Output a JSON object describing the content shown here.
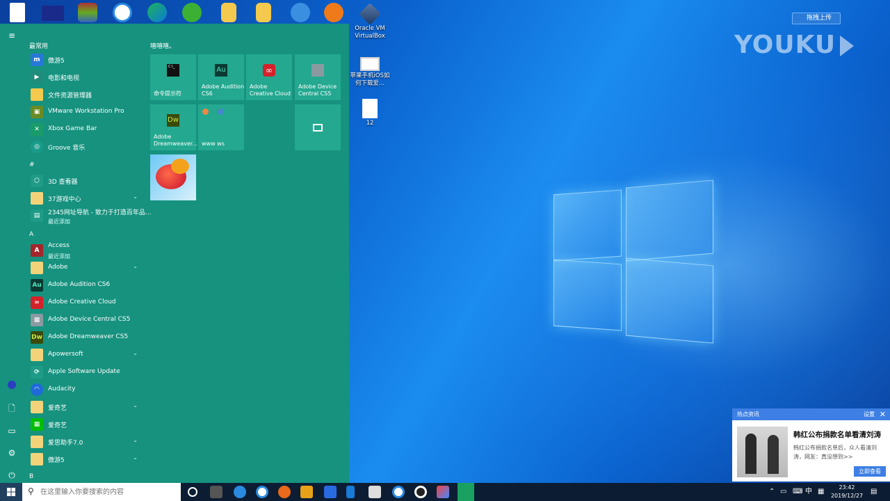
{
  "desktop": {
    "icons": [
      {
        "label": "Oracle VM VirtualBox"
      },
      {
        "label": "苹果手机iOS如何下载爱..."
      },
      {
        "label": "12"
      }
    ],
    "watermark": "YOUKU",
    "upload_button": "拖拽上传"
  },
  "start_menu": {
    "sections": {
      "frequent": "最常用",
      "hash": "#",
      "a": "A",
      "b": "B"
    },
    "apps": [
      {
        "label": "傲游5"
      },
      {
        "label": "电影和电视"
      },
      {
        "label": "文件资源管理器"
      },
      {
        "label": "VMware Workstation Pro"
      },
      {
        "label": "Xbox Game Bar"
      },
      {
        "label": "Groove 音乐"
      },
      {
        "label": "3D 查看器"
      },
      {
        "label": "37游戏中心"
      },
      {
        "label": "2345网址导航 - 致力于打造百年品...",
        "sub": "最近添加"
      },
      {
        "label": "Access",
        "sub": "最近添加"
      },
      {
        "label": "Adobe"
      },
      {
        "label": "Adobe Audition CS6"
      },
      {
        "label": "Adobe Creative Cloud"
      },
      {
        "label": "Adobe Device Central CS5"
      },
      {
        "label": "Adobe Dreamweaver CS5"
      },
      {
        "label": "Apowersoft"
      },
      {
        "label": "Apple Software Update"
      },
      {
        "label": "Audacity"
      },
      {
        "label": "爱奇艺"
      },
      {
        "label": "爱奇艺"
      },
      {
        "label": "爱思助手7.0"
      },
      {
        "label": "傲游5"
      }
    ],
    "tiles_header": "嘻嘻嘻。",
    "tiles": [
      {
        "label": "命令提示符"
      },
      {
        "label": "Adobe Audition CS6"
      },
      {
        "label": "Adobe Creative Cloud"
      },
      {
        "label": "Adobe Device Central CS5"
      },
      {
        "label": "Adobe Dreamweaver..."
      },
      {
        "label": "www ws"
      }
    ],
    "tile_icon_text": {
      "au": "Au",
      "dw": "Dw",
      "cmd": "C:\\_"
    }
  },
  "news_popup": {
    "header": "热点资讯",
    "settings": "设置",
    "close": "✕",
    "headline": "韩红公布捐款名单看清刘涛",
    "body": "韩红公布捐款名单后，众人看清刘涛，网友：真没想到>>",
    "button": "立即查看"
  },
  "taskbar": {
    "search_placeholder": "在这里输入你要搜索的内容",
    "ime": "中",
    "time": "23:42",
    "date": "2019/12/27"
  },
  "app_icon_text": {
    "access": "A",
    "au": "Au",
    "dw": "Dw"
  },
  "colors": {
    "start_menu_bg": "#16927f",
    "tile_bg": "#24a890",
    "taskbar_bg": "#0c1d33",
    "news_accent": "#3d7fe4"
  }
}
